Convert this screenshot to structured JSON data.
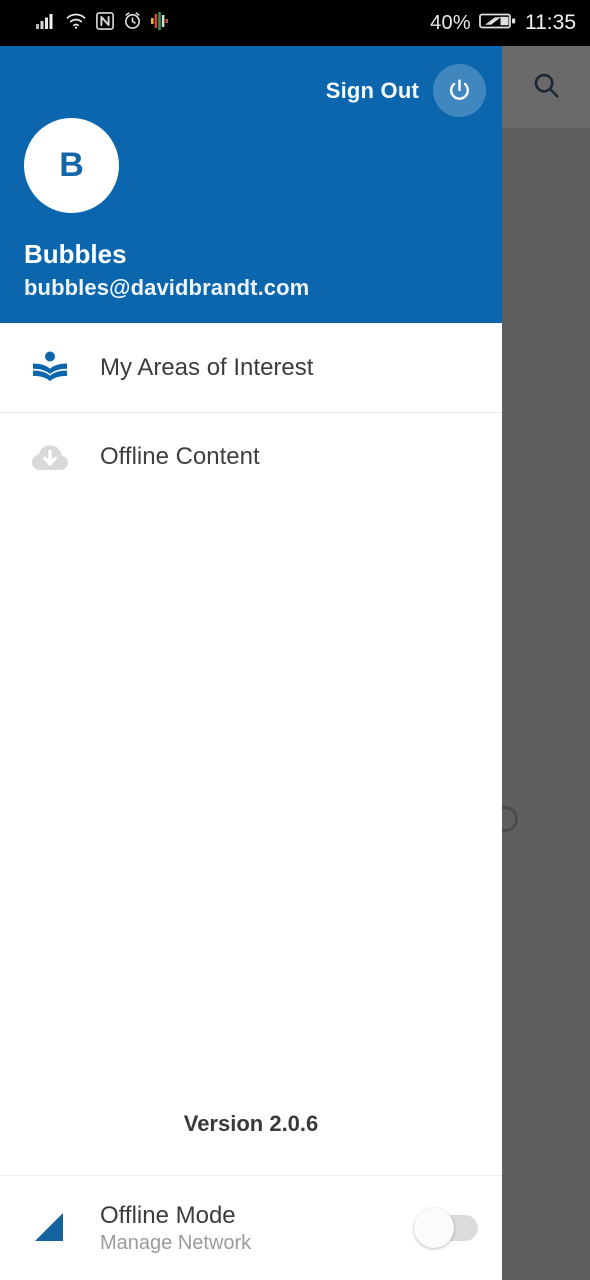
{
  "status_bar": {
    "icons": [
      "signal-icon",
      "wifi-icon",
      "nfc-icon",
      "alarm-icon",
      "equalizer-icon"
    ],
    "battery_percent": "40%",
    "time": "11:35"
  },
  "drawer": {
    "header": {
      "sign_out_label": "Sign Out",
      "power_icon": "power-icon",
      "avatar_initial": "B",
      "user_name": "Bubbles",
      "user_email": "bubbles@davidbrandt.com",
      "background_color": "#0b66ad"
    },
    "menu_items": [
      {
        "label": "My Areas of Interest",
        "icon": "reader-book-icon",
        "icon_color": "#0b66ad"
      },
      {
        "label": "Offline Content",
        "icon": "cloud-download-icon",
        "icon_color": "#d8d8d8"
      }
    ],
    "version_label": "Version 2.0.6",
    "footer": {
      "icon": "network-triangle-icon",
      "icon_color": "#14629e",
      "title": "Offline Mode",
      "subtitle": "Manage Network",
      "toggle_state": "off"
    }
  },
  "background_app": {
    "search_icon": "search-icon",
    "scrim_color": "#5f5f5f"
  }
}
